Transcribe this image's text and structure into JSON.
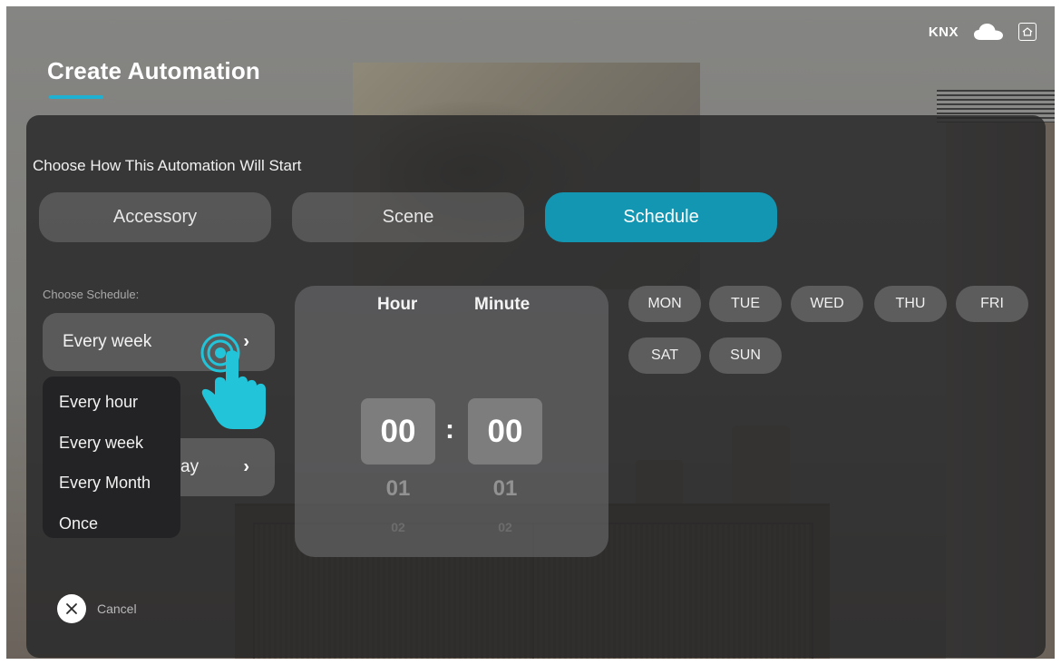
{
  "status_bar": {
    "knx": "KNX"
  },
  "title": "Create Automation",
  "section_heading": "Choose How This Automation Will Start",
  "trigger_types": [
    {
      "label": "Accessory",
      "active": false
    },
    {
      "label": "Scene",
      "active": false
    },
    {
      "label": "Schedule",
      "active": true
    }
  ],
  "schedule": {
    "label": "Choose Schedule:",
    "selected": "Every week",
    "second_select_partial": "ay",
    "options": [
      "Every hour",
      "Every week",
      "Every Month",
      "Once"
    ]
  },
  "time_picker": {
    "hour_label": "Hour",
    "minute_label": "Minute",
    "hour_value": "00",
    "minute_value": "00",
    "separator": ":",
    "hour_next": "01",
    "minute_next": "01",
    "hour_next2": "02",
    "minute_next2": "02"
  },
  "days": [
    "MON",
    "TUE",
    "WED",
    "THU",
    "FRI",
    "SAT",
    "SUN"
  ],
  "cancel_label": "Cancel",
  "colors": {
    "accent": "#1fb1d2",
    "active_button": "#1396b2",
    "pointer": "#22c4d9"
  }
}
